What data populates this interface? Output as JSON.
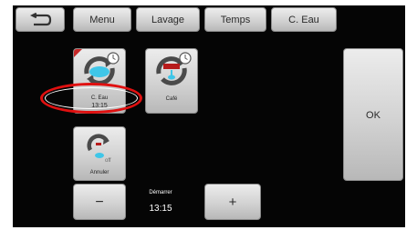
{
  "tabs": [
    {
      "label": "Menu"
    },
    {
      "label": "Lavage"
    },
    {
      "label": "Temps"
    },
    {
      "label": "C. Eau"
    }
  ],
  "programs": {
    "ceau": {
      "label": "C. Eau",
      "time": "13:15"
    },
    "cafe": {
      "label": "Café"
    },
    "annuler": {
      "label": "Annuler"
    }
  },
  "controls": {
    "minus": "−",
    "plus": "+",
    "ok": "OK"
  },
  "status": {
    "label": "Démarrer",
    "time": "13:15"
  },
  "colors": {
    "accent_cyan": "#3fc6e8",
    "accent_red": "#c62828",
    "highlight_ring": "#e01010"
  }
}
